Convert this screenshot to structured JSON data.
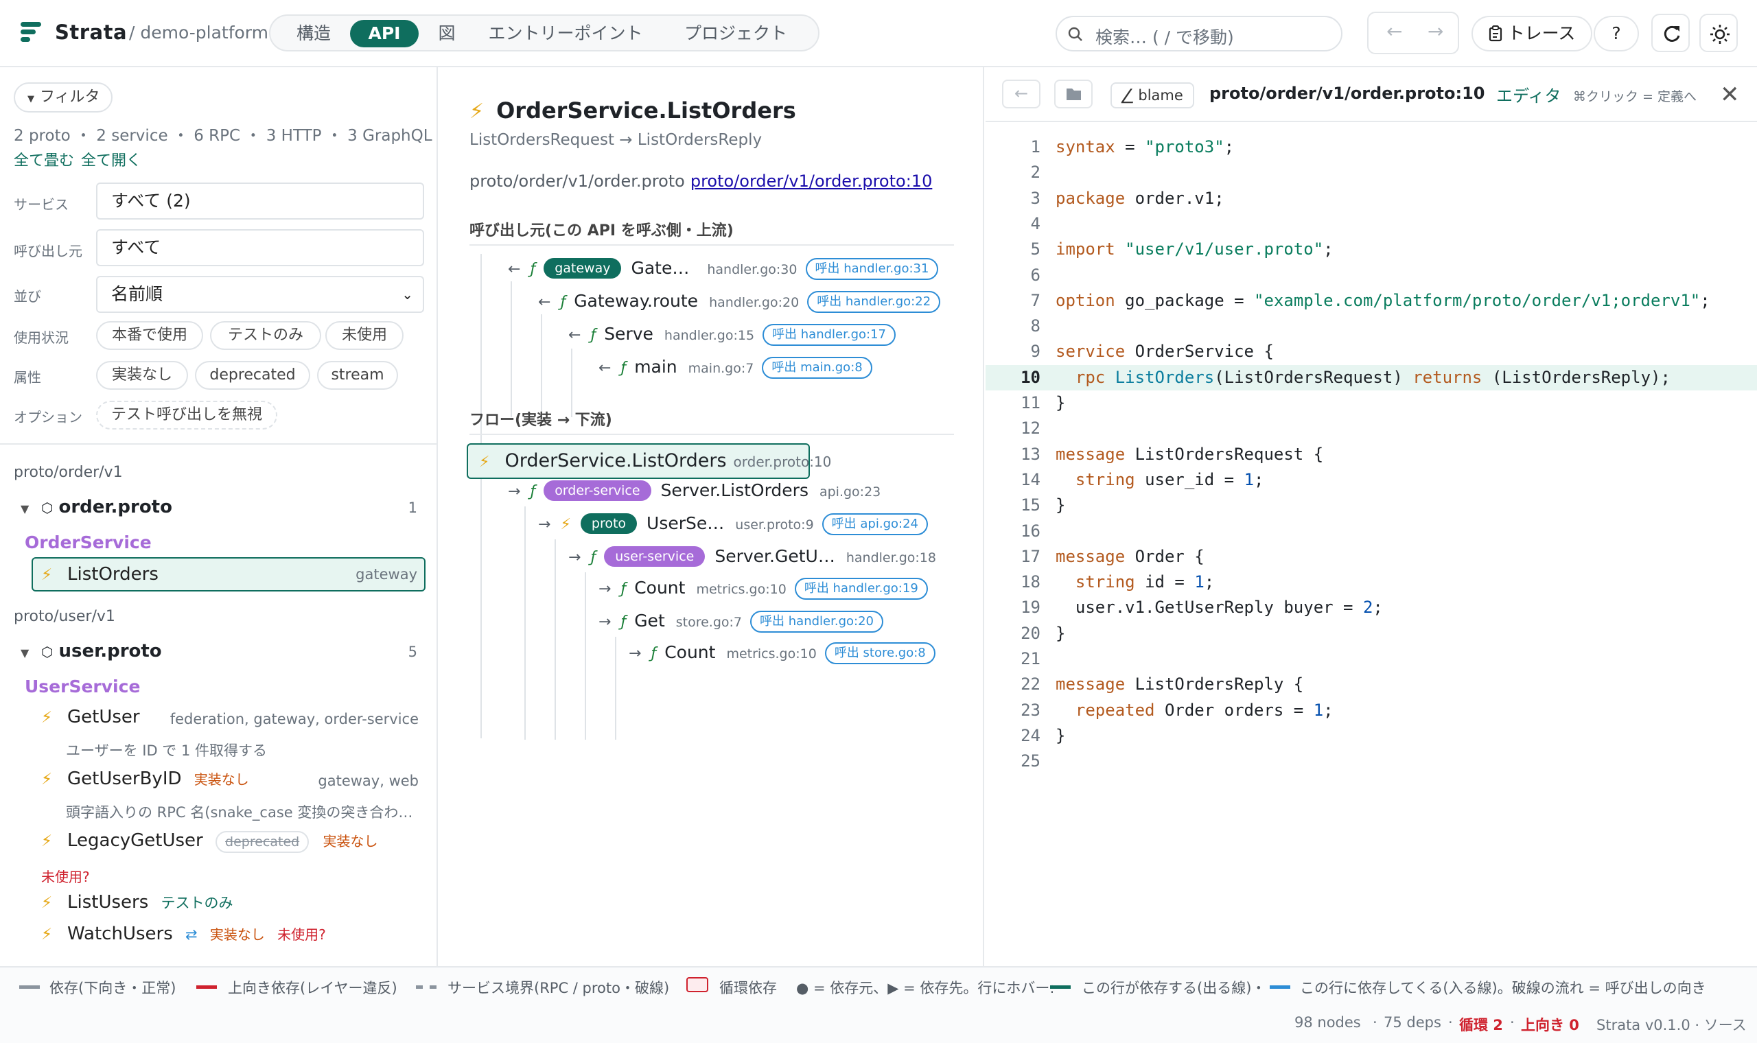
{
  "colors": {
    "accent": "#0f6e5e",
    "service": "#a66bd8",
    "warn": "#c9510c",
    "danger": "#cf222e",
    "link": "#2d8dd6"
  },
  "topbar": {
    "brand": "Strata",
    "repo": "/ demo-platform",
    "tabs": [
      "構造",
      "API",
      "図",
      "エントリーポイント",
      "プロジェクト"
    ],
    "active_tab": "API",
    "search_placeholder": "検索… ( / で移動)",
    "back": "←",
    "forward": "→",
    "trace_label": "トレース",
    "help_label": "?",
    "icons": [
      "logo-icon",
      "search-icon",
      "clipboard-icon",
      "refresh-icon",
      "sun-icon"
    ]
  },
  "sidebar": {
    "filter_toggle": "フィルタ",
    "counts": "2 proto ・ 2 service ・ 6 RPC ・ 3 HTTP ・ 3 GraphQL",
    "collapse_all": "全て畳む",
    "expand_all": "全て開く",
    "service_label": "サービス",
    "service_value": "すべて (2)",
    "caller_label": "呼び出し元",
    "caller_value": "すべて",
    "sort_label": "並び",
    "sort_value": "名前順",
    "usage_label": "使用状況",
    "usage_chips": [
      "本番で使用",
      "テストのみ",
      "未使用"
    ],
    "attr_label": "属性",
    "attr_chips": [
      "実装なし",
      "deprecated",
      "stream"
    ],
    "option_label": "オプション",
    "option_chip": "テスト呼び出しを無視",
    "groups": [
      {
        "path": "proto/order/v1",
        "file": "order.proto",
        "count": "1",
        "service": "OrderService",
        "rpcs": [
          {
            "name": "ListOrders",
            "callers": "gateway"
          }
        ]
      },
      {
        "path": "proto/user/v1",
        "file": "user.proto",
        "count": "5",
        "service": "UserService",
        "rpcs": [
          {
            "name": "GetUser",
            "callers": "federation, gateway, order-service",
            "desc": "ユーザーを ID で 1 件取得する"
          },
          {
            "name": "GetUserByID",
            "tag": "実装なし",
            "callers": "gateway, web",
            "desc": "頭字語入りの RPC 名(snake_case 変換の突き合わ…"
          },
          {
            "name": "LegacyGetUser",
            "deprecated": "deprecated",
            "tag": "実装なし",
            "unused": "未使用?"
          },
          {
            "name": "ListUsers",
            "test": "テストのみ"
          },
          {
            "name": "WatchUsers",
            "stream": "⇄",
            "tag": "実装なし",
            "unused": "未使用?"
          }
        ]
      }
    ]
  },
  "middle": {
    "title": "OrderService.ListOrders",
    "subtitle": "ListOrdersRequest → ListOrdersReply",
    "path_text": "proto/order/v1/order.proto",
    "path_link": "proto/order/v1/order.proto:10",
    "callers_title": "呼び出し元(この API を呼ぶ側・上流)",
    "callers": [
      {
        "arrow": "←",
        "pill": "gateway",
        "name": "Gate…",
        "loc": "handler.go:30",
        "call": "呼出 handler.go:31"
      },
      {
        "arrow": "←",
        "name": "Gateway.route",
        "loc": "handler.go:20",
        "call": "呼出 handler.go:22"
      },
      {
        "arrow": "←",
        "name": "Serve",
        "loc": "handler.go:15",
        "call": "呼出 handler.go:17"
      },
      {
        "arrow": "←",
        "name": "main",
        "loc": "main.go:7",
        "call": "呼出 main.go:8"
      }
    ],
    "flow_title": "フロー(実装 → 下流)",
    "root": {
      "name": "OrderService.ListOrders",
      "loc": "order.proto:10"
    },
    "flow": [
      {
        "arrow": "→",
        "pill": "order-service",
        "name": "Server.ListOrders",
        "loc": "api.go:23"
      },
      {
        "arrow": "→",
        "pill": "proto",
        "name": "UserSe…",
        "loc": "user.proto:9",
        "call": "呼出 api.go:24"
      },
      {
        "arrow": "→",
        "pill": "user-service",
        "name": "Server.GetU…",
        "loc": "handler.go:18"
      },
      {
        "arrow": "→",
        "name": "Count",
        "loc": "metrics.go:10",
        "call": "呼出 handler.go:19"
      },
      {
        "arrow": "→",
        "name": "Get",
        "loc": "store.go:7",
        "call": "呼出 handler.go:20"
      },
      {
        "arrow": "→",
        "name": "Count",
        "loc": "metrics.go:10",
        "call": "呼出 store.go:8"
      }
    ]
  },
  "code": {
    "back": "←",
    "blame": "blame",
    "path": "proto/order/v1/order.proto:10",
    "editor_label": "エディタ",
    "hint": "⌘クリック = 定義へ",
    "close": "✕",
    "highlight_line": 10,
    "lines": [
      "syntax = \"proto3\";",
      "",
      "package order.v1;",
      "",
      "import \"user/v1/user.proto\";",
      "",
      "option go_package = \"example.com/platform/proto/order/v1;orderv1\";",
      "",
      "service OrderService {",
      "  rpc ListOrders(ListOrdersRequest) returns (ListOrdersReply);",
      "}",
      "",
      "message ListOrdersRequest {",
      "  string user_id = 1;",
      "}",
      "",
      "message Order {",
      "  string id = 1;",
      "  user.v1.GetUserReply buyer = 2;",
      "}",
      "",
      "message ListOrdersReply {",
      "  repeated Order orders = 1;",
      "}",
      ""
    ]
  },
  "legend": {
    "dep_normal": "依存(下向き・正常)",
    "dep_up": "上向き依存(レイヤー違反)",
    "service_boundary": "サービス境界(RPC / proto・破線)",
    "cycle": "循環依存",
    "hover_hint": "● = 依存元、▶ = 依存先。行にホバー:",
    "out_edges": "この行が依存する(出る線)・",
    "in_edges": "この行に依存してくる(入る線)。破線の流れ = 呼び出しの向き"
  },
  "status": {
    "nodes": "98 nodes",
    "deps": "75 deps",
    "cycles": "循環 2",
    "upward": "上向き 0",
    "version": "Strata v0.1.0 · ソース"
  }
}
